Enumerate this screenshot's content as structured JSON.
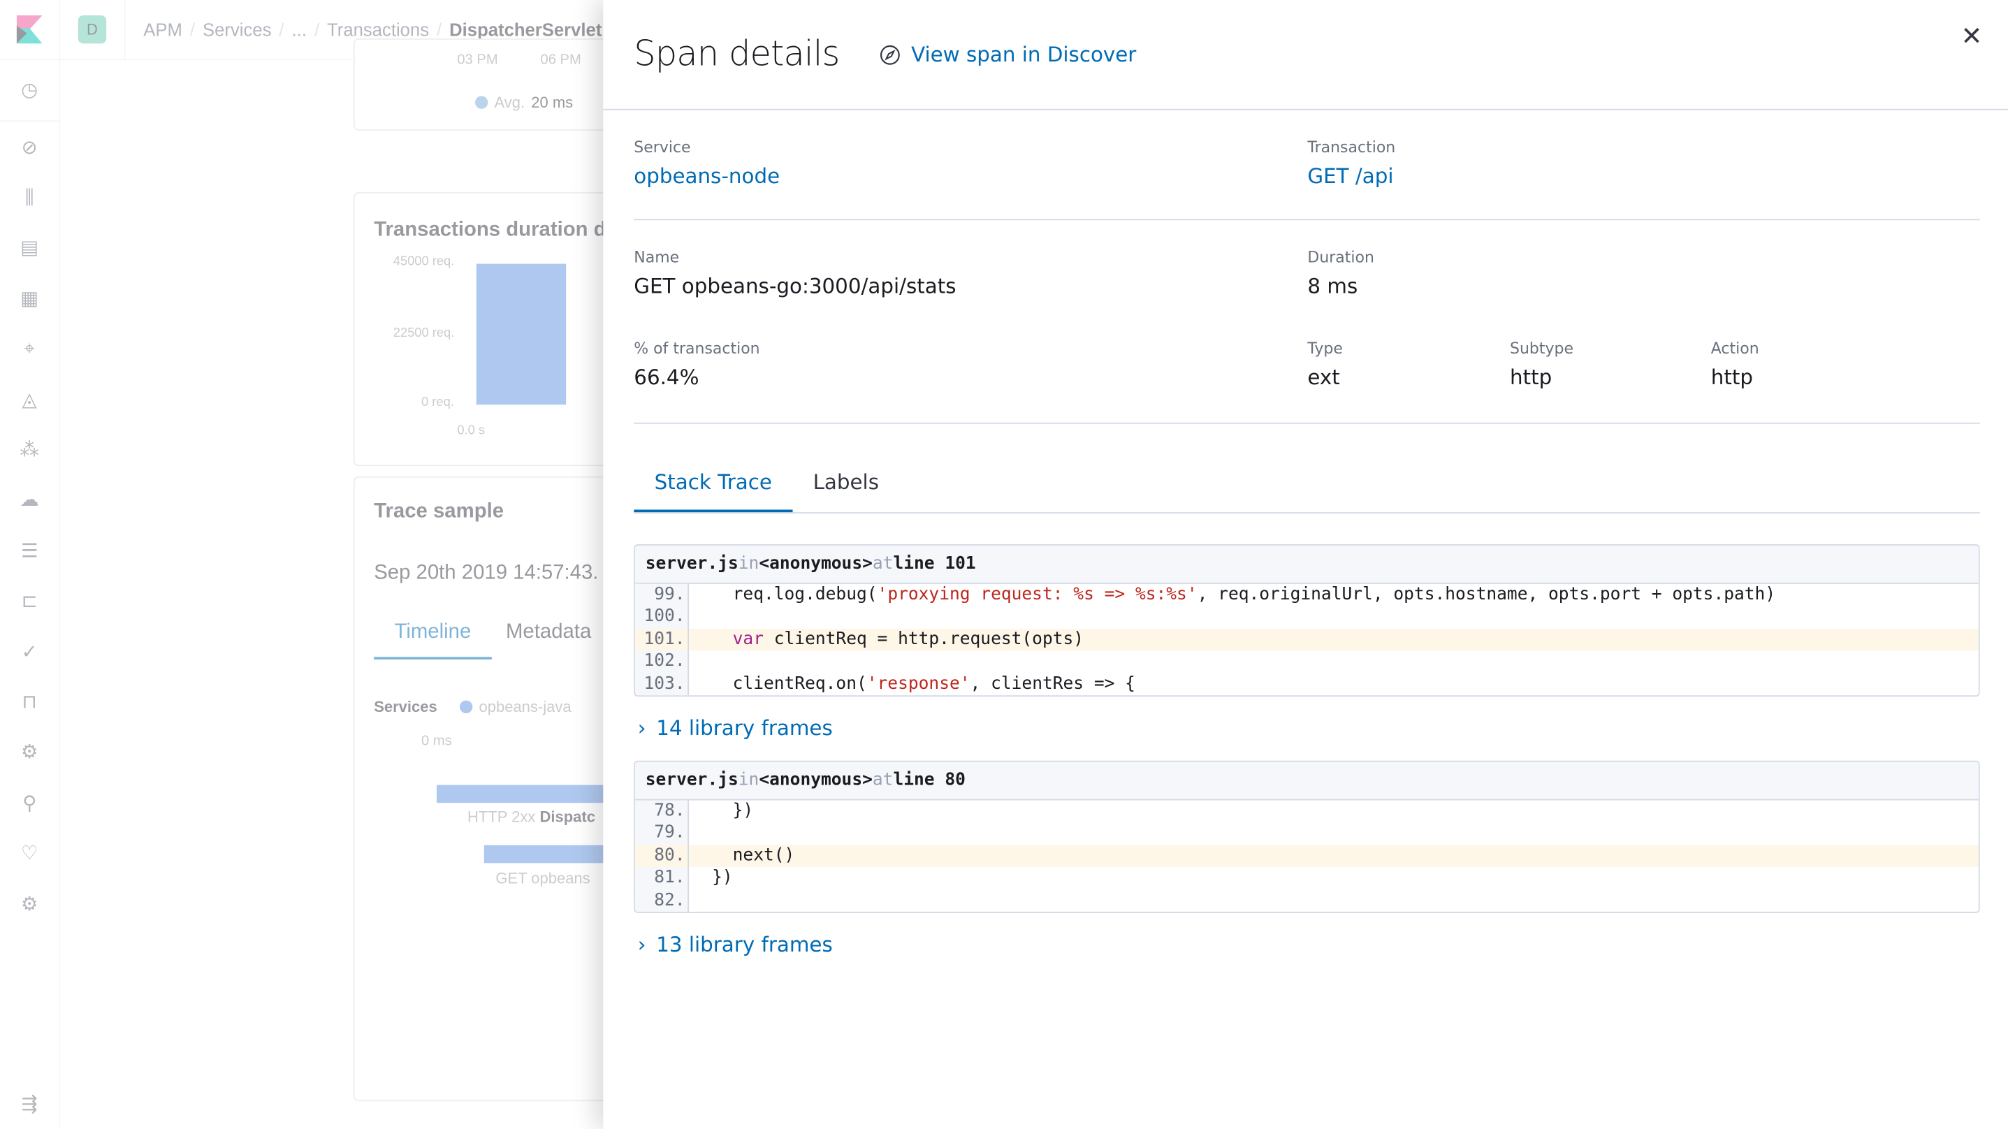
{
  "background": {
    "space_initial": "D",
    "breadcrumbs": [
      "APM",
      "Services",
      "...",
      "Transactions",
      "DispatcherServlet"
    ],
    "chart_legend": {
      "label": "Avg.",
      "value": "20 ms"
    },
    "chart_axis_top": [
      "03 PM",
      "06 PM"
    ],
    "distribution": {
      "title": "Transactions duration distribution",
      "y_ticks": [
        "45000 req.",
        "22500 req.",
        "0 req."
      ],
      "x_tick": "0.0 s"
    },
    "trace": {
      "title": "Trace sample",
      "timestamp": "Sep 20th 2019 14:57:43.",
      "tabs": [
        "Timeline",
        "Metadata"
      ],
      "services_label": "Services",
      "service": "opbeans-java",
      "axis": "0 ms",
      "row1_status": "HTTP 2xx",
      "row1_name": "Dispatc",
      "row2_name": "GET opbeans"
    },
    "nav_icons": [
      "clock-icon",
      "discover-icon",
      "visualize-icon",
      "dashboard-icon",
      "canvas-icon",
      "maps-icon",
      "ml-icon",
      "graph-icon",
      "infra-icon",
      "logs-icon",
      "apm-icon",
      "uptime-icon",
      "siem-icon",
      "dev-tools-icon",
      "monitoring-icon",
      "heartbeat-icon",
      "management-icon",
      "collapse-icon"
    ]
  },
  "flyout": {
    "title": "Span details",
    "discover_link": "View span in Discover",
    "service": {
      "label": "Service",
      "value": "opbeans-node"
    },
    "transaction": {
      "label": "Transaction",
      "value": "GET /api"
    },
    "name": {
      "label": "Name",
      "value": "GET opbeans-go:3000/api/stats"
    },
    "duration": {
      "label": "Duration",
      "value": "8 ms"
    },
    "percent": {
      "label": "% of transaction",
      "value": "66.4%"
    },
    "type": {
      "label": "Type",
      "value": "ext"
    },
    "subtype": {
      "label": "Subtype",
      "value": "http"
    },
    "action": {
      "label": "Action",
      "value": "http"
    },
    "tabs": [
      "Stack Trace",
      "Labels"
    ],
    "frames": [
      {
        "file": "server.js",
        "in": "in",
        "fn": "<anonymous>",
        "at": "at",
        "line": "line 101",
        "lines": [
          {
            "no": "99.",
            "pre": "  req.log.debug(",
            "str": "'proxying request: %s => %s:%s'",
            "post": ", req.originalUrl, opts.hostname, opts.port + opts.path)"
          },
          {
            "no": "100.",
            "pre": "",
            "str": "",
            "post": ""
          },
          {
            "no": "101.",
            "kw": "var",
            "pre": "  ",
            "post": " clientReq = http.request(opts)",
            "highlight": true
          },
          {
            "no": "102.",
            "pre": "",
            "str": "",
            "post": ""
          },
          {
            "no": "103.",
            "pre": "  clientReq.on(",
            "str": "'response'",
            "post": ", clientRes => {"
          }
        ]
      },
      {
        "file": "server.js",
        "in": "in",
        "fn": "<anonymous>",
        "at": "at",
        "line": "line 80",
        "lines": [
          {
            "no": "78.",
            "pre": "  })",
            "str": "",
            "post": ""
          },
          {
            "no": "79.",
            "pre": "",
            "str": "",
            "post": ""
          },
          {
            "no": "80.",
            "pre": "  next()",
            "str": "",
            "post": "",
            "highlight": true
          },
          {
            "no": "81.",
            "pre": "})",
            "str": "",
            "post": ""
          },
          {
            "no": "82.",
            "pre": "",
            "str": "",
            "post": ""
          }
        ]
      }
    ],
    "library_frames": [
      "14 library frames",
      "13 library frames"
    ]
  },
  "colors": {
    "link": "#006bb4",
    "highlight": "#fef6e6",
    "string": "#bd271e",
    "keyword": "#a0228d"
  }
}
